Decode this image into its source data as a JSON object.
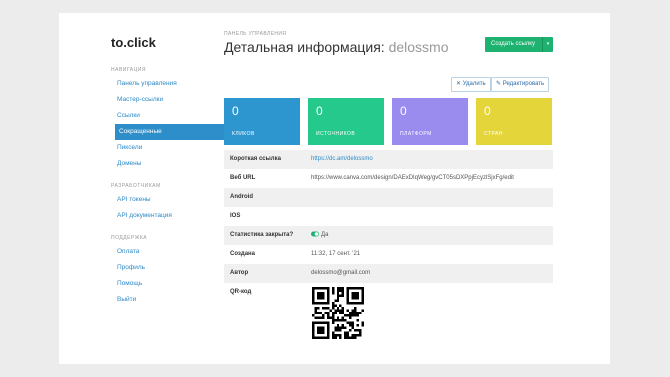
{
  "app": {
    "logo": "to.click"
  },
  "sidebar": {
    "sections": [
      {
        "heading": "НАВИГАЦИЯ",
        "items": [
          {
            "label": "Панель управления",
            "sub": false,
            "active": false
          },
          {
            "label": "Мастер-ссылки",
            "sub": false,
            "active": false
          },
          {
            "label": "Ссылки",
            "sub": false,
            "active": false
          },
          {
            "label": "Сокращенные",
            "sub": true,
            "active": true
          },
          {
            "label": "Пиксели",
            "sub": false,
            "active": false
          },
          {
            "label": "Домены",
            "sub": false,
            "active": false
          }
        ]
      },
      {
        "heading": "РАЗРАБОТЧИКАМ",
        "items": [
          {
            "label": "API токены",
            "sub": false,
            "active": false
          },
          {
            "label": "API документация",
            "sub": false,
            "active": false
          }
        ]
      },
      {
        "heading": "ПОДДЕРЖКА",
        "items": [
          {
            "label": "Оплата",
            "sub": false,
            "active": false
          },
          {
            "label": "Профиль",
            "sub": false,
            "active": false
          },
          {
            "label": "Помощь",
            "sub": false,
            "active": false
          },
          {
            "label": "Выйти",
            "sub": false,
            "active": false
          }
        ]
      }
    ]
  },
  "header": {
    "breadcrumb": "ПАНЕЛЬ УПРАВЛЕНИЯ",
    "title_main": "Детальная информация: ",
    "title_sub": "delossmo",
    "create_button": "Создать ссылку",
    "caret": "▾"
  },
  "actions": {
    "delete_icon": "✕",
    "delete_label": "Удалить",
    "edit_icon": "✎",
    "edit_label": "Редактировать"
  },
  "stats": [
    {
      "value": "0",
      "label": "КЛИКОВ",
      "color": "#2e96cf"
    },
    {
      "value": "0",
      "label": "ИСТОЧНИКОВ",
      "color": "#24c98b"
    },
    {
      "value": "0",
      "label": "ПЛАТФОРМ",
      "color": "#9a8bef"
    },
    {
      "value": "0",
      "label": "СТРАН",
      "color": "#e4d63a"
    }
  ],
  "details": [
    {
      "key": "Короткая ссылка",
      "value": "https://dc.am/delossmo",
      "link": true
    },
    {
      "key": "Веб URL",
      "value": "https://www.canva.com/design/DAExDIqWeg/gvCT05sDXPpjEcyzlSjxFg/edit",
      "link": false
    },
    {
      "key": "Android",
      "value": "",
      "link": false
    },
    {
      "key": "IOS",
      "value": "",
      "link": false
    },
    {
      "key": "Статистика закрыта?",
      "value": "Да",
      "link": false,
      "icon": "toggle-on-icon"
    },
    {
      "key": "Создана",
      "value": "11:32, 17 сент. '21",
      "link": false
    },
    {
      "key": "Автор",
      "value": "delossmo@gmail.com",
      "link": false
    }
  ],
  "qr": {
    "label": "QR-код",
    "icon": "qr-code-icon"
  }
}
